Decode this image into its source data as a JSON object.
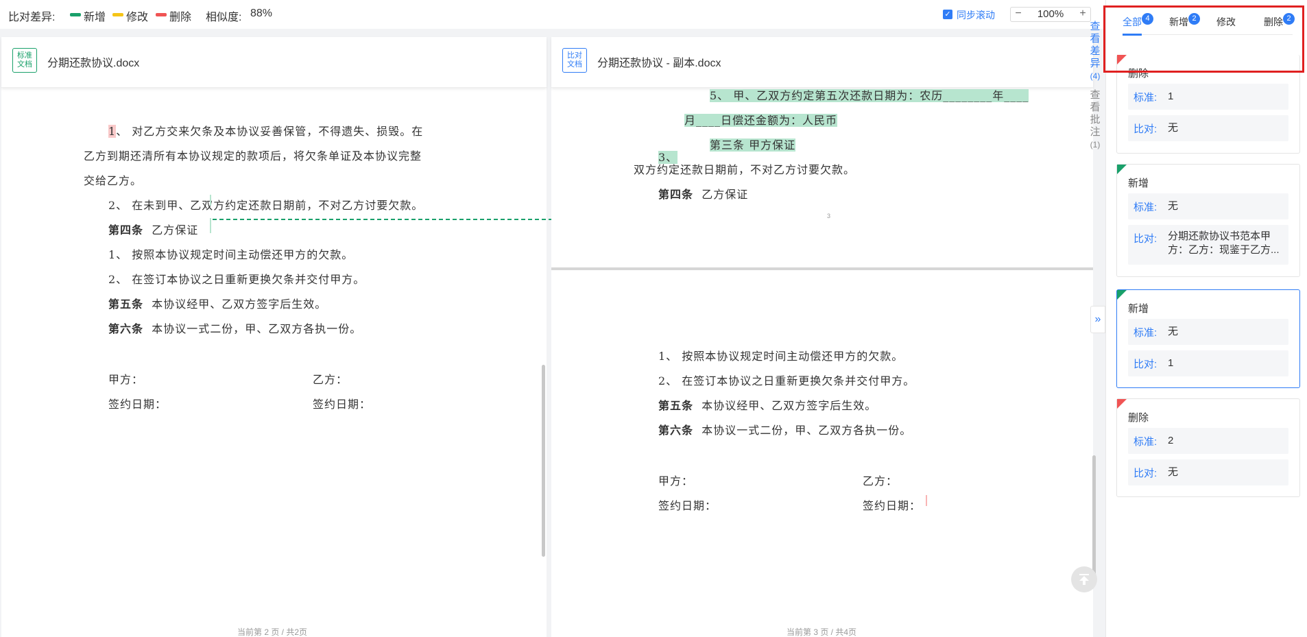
{
  "toolbar": {
    "diff_label": "比对差异:",
    "legend": [
      {
        "label": "新增",
        "color": "#19a06a"
      },
      {
        "label": "修改",
        "color": "#f5c518"
      },
      {
        "label": "删除",
        "color": "#f05454"
      }
    ],
    "similarity_label": "相似度:",
    "similarity_value": "88%",
    "sync_scroll_label": "同步滚动",
    "sync_scroll_checked": true,
    "zoom_minus": "−",
    "zoom_value": "100%",
    "zoom_plus": "+"
  },
  "left_doc": {
    "badge": "标准\n文档",
    "badge_line1": "标准",
    "badge_line2": "文档",
    "title": "分期还款协议.docx",
    "lines": {
      "l1_num": "1",
      "l1_rest": "、 对乙方交来欠条及本协议妥善保管，不得遗失、损毁。在",
      "l2": "乙方到期还清所有本协议规定的款项后，将欠条单证及本协议完整",
      "l3": "交给乙方。",
      "l4": "2、 在未到甲、乙双方约定还款日期前，不对乙方讨要欠款。",
      "l5_bold": "第四条",
      "l5_rest": "乙方保证",
      "l6": "1、 按照本协议规定时间主动偿还甲方的欠款。",
      "l7": "2、 在签订本协议之日重新更换欠条并交付甲方。",
      "l8_bold": "第五条",
      "l8_rest": "本协议经甲、乙双方签字后生效。",
      "l9_bold": "第六条",
      "l9_rest": "本协议一式二份，甲、乙双方各执一份。",
      "party_a": "甲方：",
      "party_b": "乙方：",
      "date_a": "签约日期：",
      "date_b": "签约日期："
    },
    "page_footer": "当前第 2 页 / 共2页"
  },
  "right_doc": {
    "badge_line1": "比对",
    "badge_line2": "文档",
    "title": "分期还款协议 - 副本.docx",
    "lines": {
      "g1": "5、 甲、乙双方约定第五次还款日期为：农历________年____",
      "g2": "月____日偿还金额为：人民币",
      "g3": "第三条  甲方保证",
      "g4": "3、",
      "l5": "双方约定还款日期前，不对乙方讨要欠款。",
      "l6_bold": "第四条",
      "l6_rest": "乙方保证",
      "page_mark": "3",
      "p1": "1、 按照本协议规定时间主动偿还甲方的欠款。",
      "p2": "2、 在签订本协议之日重新更换欠条并交付甲方。",
      "p3_bold": "第五条",
      "p3_rest": "本协议经甲、乙双方签字后生效。",
      "p4_bold": "第六条",
      "p4_rest": "本协议一式二份，甲、乙双方各执一份。",
      "party_a": "甲方：",
      "party_b": "乙方：",
      "date_a": "签约日期：",
      "date_b": "签约日期："
    },
    "page_footer": "当前第 3 页 / 共4页"
  },
  "side_tabs": {
    "view_diff": "查看差异",
    "view_diff_count": "(4)",
    "view_comments": "查看批注",
    "view_comments_count": "(1)",
    "collapse_icon": "double-chevron-right-icon",
    "back_to_top_icon": "arrow-up-icon"
  },
  "diff_panel": {
    "tabs": [
      {
        "label": "全部",
        "count": "4",
        "active": true
      },
      {
        "label": "新增",
        "count": "2",
        "active": false
      },
      {
        "label": "修改",
        "count": "",
        "active": false
      },
      {
        "label": "删除",
        "count": "2",
        "active": false
      }
    ],
    "key_standard": "标准:",
    "key_compare": "比对:",
    "cards": [
      {
        "type": "删除",
        "color": "#f05454",
        "standard": "1",
        "compare": "无"
      },
      {
        "type": "新增",
        "color": "#19a06a",
        "standard": "无",
        "compare": "分期还款协议书范本甲方：乙方：现鉴于乙方..."
      },
      {
        "type": "新增",
        "color": "#19a06a",
        "standard": "无",
        "compare": "1",
        "selected": true
      },
      {
        "type": "删除",
        "color": "#f05454",
        "standard": "2",
        "compare": "无"
      }
    ]
  }
}
